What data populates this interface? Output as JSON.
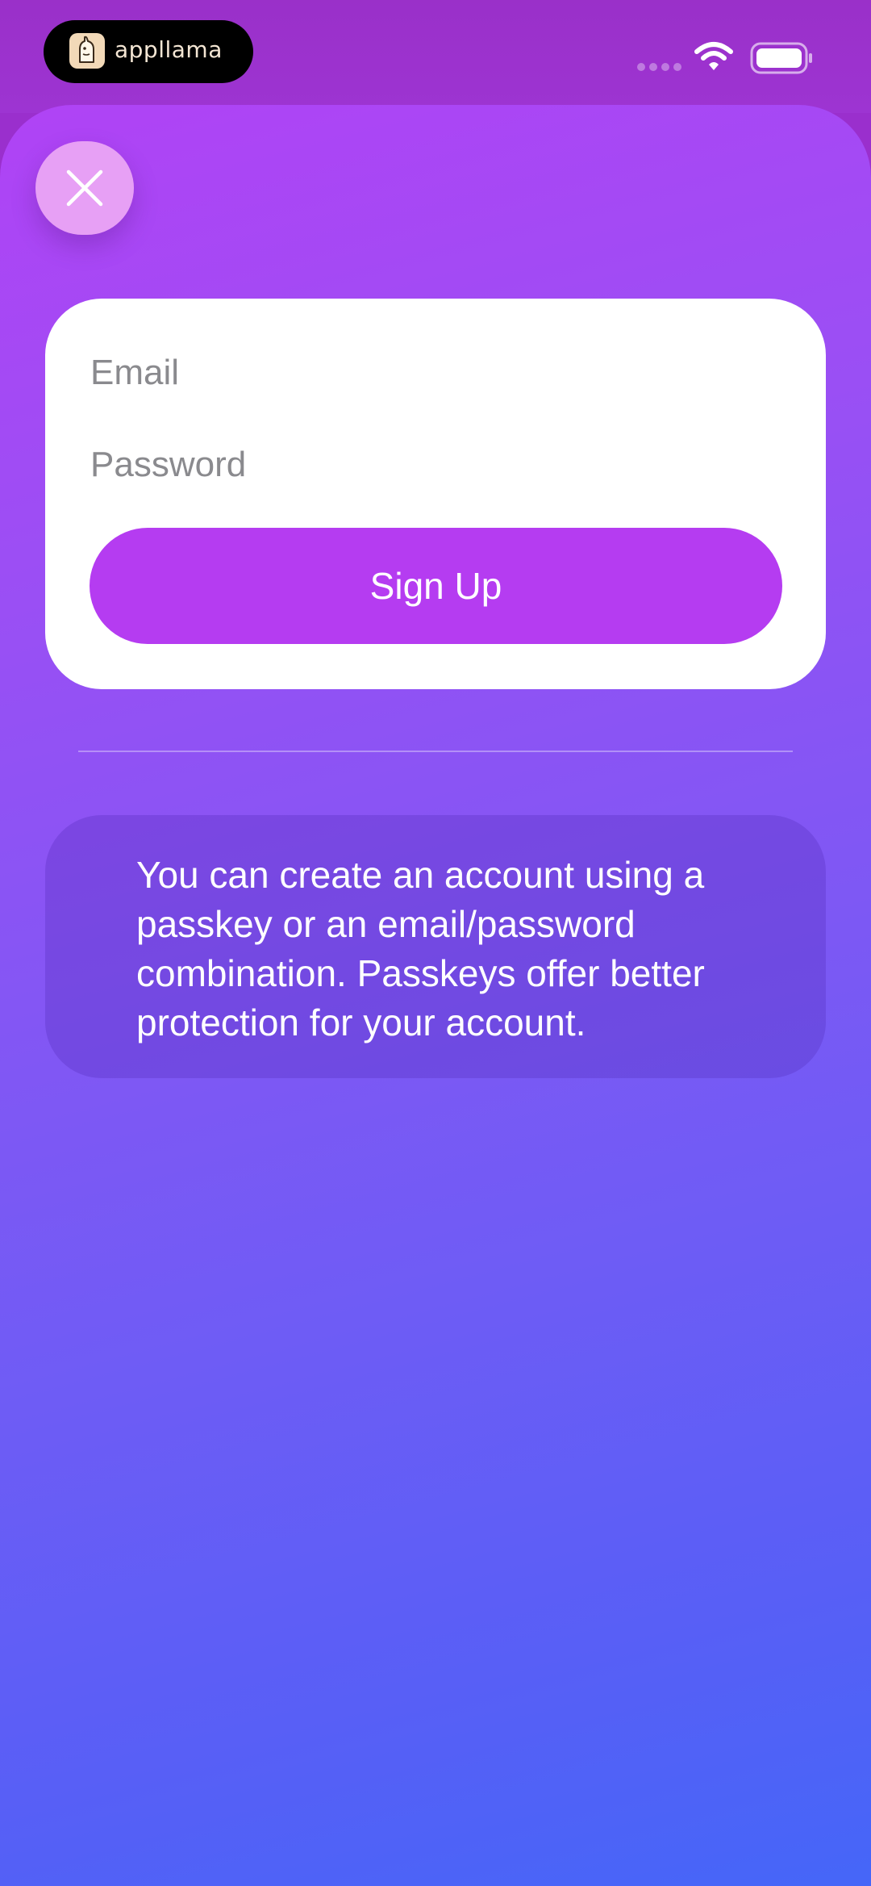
{
  "status_bar": {
    "app_name": "appllama"
  },
  "form": {
    "email_placeholder": "Email",
    "password_placeholder": "Password",
    "signup_label": "Sign Up"
  },
  "info": {
    "text": "You can create an account using a passkey or an email/password combination. Passkeys offer better protection for your account."
  },
  "icons": {
    "close": "close-icon",
    "wifi": "wifi-icon",
    "battery": "battery-icon",
    "logo": "llama-logo-icon"
  },
  "colors": {
    "accent": "#b53cf1",
    "sheet_top": "#b043f5",
    "sheet_bottom": "#4566f8"
  }
}
